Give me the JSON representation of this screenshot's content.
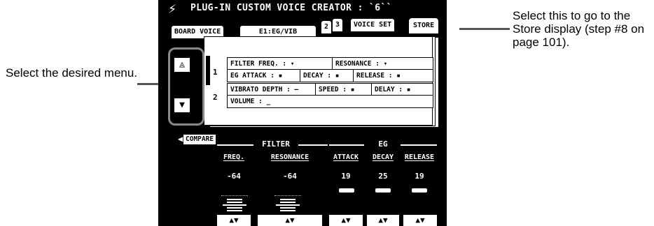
{
  "annotations": {
    "left": "Select the desired menu.",
    "right": "Select this to go to the Store display (step #8 on page 101)."
  },
  "screen": {
    "title": "PLUG-IN CUSTOM VOICE CREATOR : `6``",
    "tabs": [
      {
        "label": "BOARD VOICE"
      },
      {
        "label": "E1:EG/VIB"
      },
      {
        "label": "2"
      },
      {
        "label": "3"
      },
      {
        "label": "VOICE SET"
      },
      {
        "label": "STORE"
      }
    ],
    "rows": [
      {
        "number": "1",
        "lines": [
          [
            "FILTER FREQ. : ▾",
            "RESONANCE : ▾"
          ],
          [
            "EG ATTACK : ▪",
            "DECAY : ▪",
            "RELEASE : ▪"
          ]
        ]
      },
      {
        "number": "2",
        "lines": [
          [
            "VIBRATO DEPTH : —",
            "SPEED : ▪",
            "DELAY : ▪"
          ],
          [
            "VOLUME : _"
          ]
        ]
      }
    ],
    "compare_label": "COMPARE",
    "groups": [
      {
        "label": "FILTER"
      },
      {
        "label": "EG"
      }
    ],
    "columns": [
      {
        "header": "FREQ.",
        "value": "-64",
        "slider": "vertical"
      },
      {
        "header": "RESONANCE",
        "value": "-64",
        "slider": "vertical"
      },
      {
        "header": "ATTACK",
        "value": "19",
        "slider": "horizontal"
      },
      {
        "header": "DECAY",
        "value": "25",
        "slider": "horizontal"
      },
      {
        "header": "RELEASE",
        "value": "19",
        "slider": "horizontal"
      }
    ],
    "button_glyph": "▲▼"
  }
}
